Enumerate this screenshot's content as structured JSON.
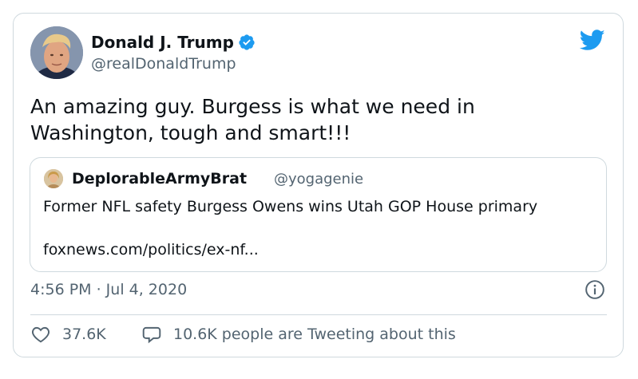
{
  "author": {
    "name": "Donald J. Trump",
    "handle": "@realDonaldTrump"
  },
  "tweet": {
    "text_line1": "An amazing guy. Burgess is what we need in",
    "text_line2": "Washington, tough and smart!!!"
  },
  "quote": {
    "name": "DeplorableArmyBrat",
    "handle": "@yogagenie",
    "text": "Former NFL safety Burgess Owens wins Utah GOP House primary",
    "link": "foxnews.com/politics/ex-nf..."
  },
  "meta": {
    "timestamp": "4:56 PM · Jul 4, 2020"
  },
  "stats": {
    "likes": "37.6K",
    "tweeting": "10.6K people are Tweeting about this"
  },
  "colors": {
    "brand": "#1d9bf0",
    "text": "#0f1419",
    "muted": "#536471",
    "border": "#cfd9de"
  },
  "icons": [
    "verified-icon",
    "twitter-bird-icon",
    "info-icon",
    "heart-icon",
    "reply-bubble-icon"
  ]
}
